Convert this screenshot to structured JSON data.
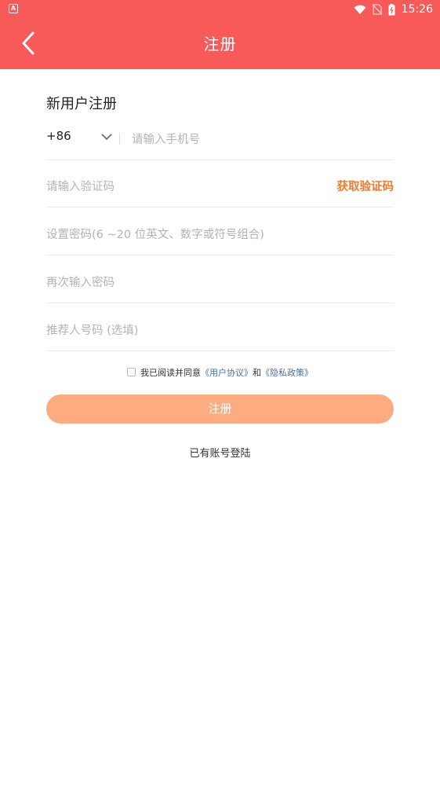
{
  "status_bar": {
    "time": "15:26",
    "left_icon_letter": "A"
  },
  "header": {
    "title": "注册"
  },
  "form": {
    "section_title": "新用户注册",
    "phone": {
      "country_code": "+86",
      "placeholder": "请输入手机号"
    },
    "code": {
      "placeholder": "请输入验证码",
      "get_code_label": "获取验证码"
    },
    "password": {
      "placeholder": "设置密码(6 ~20 位英文、数字或符号组合)"
    },
    "confirm_password": {
      "placeholder": "再次输入密码"
    },
    "referrer": {
      "placeholder": "推荐人号码 (选填)"
    }
  },
  "agreement": {
    "prefix": "我已阅读并同意",
    "user_agreement": "《用户协议》",
    "and": "和",
    "privacy_policy": "《隐私政策》"
  },
  "submit_label": "注册",
  "login_link": "已有账号登陆",
  "colors": {
    "header": "#f85a5a",
    "button": "#fcac80",
    "accent": "#f07a2c",
    "link": "#4a6fa5"
  }
}
